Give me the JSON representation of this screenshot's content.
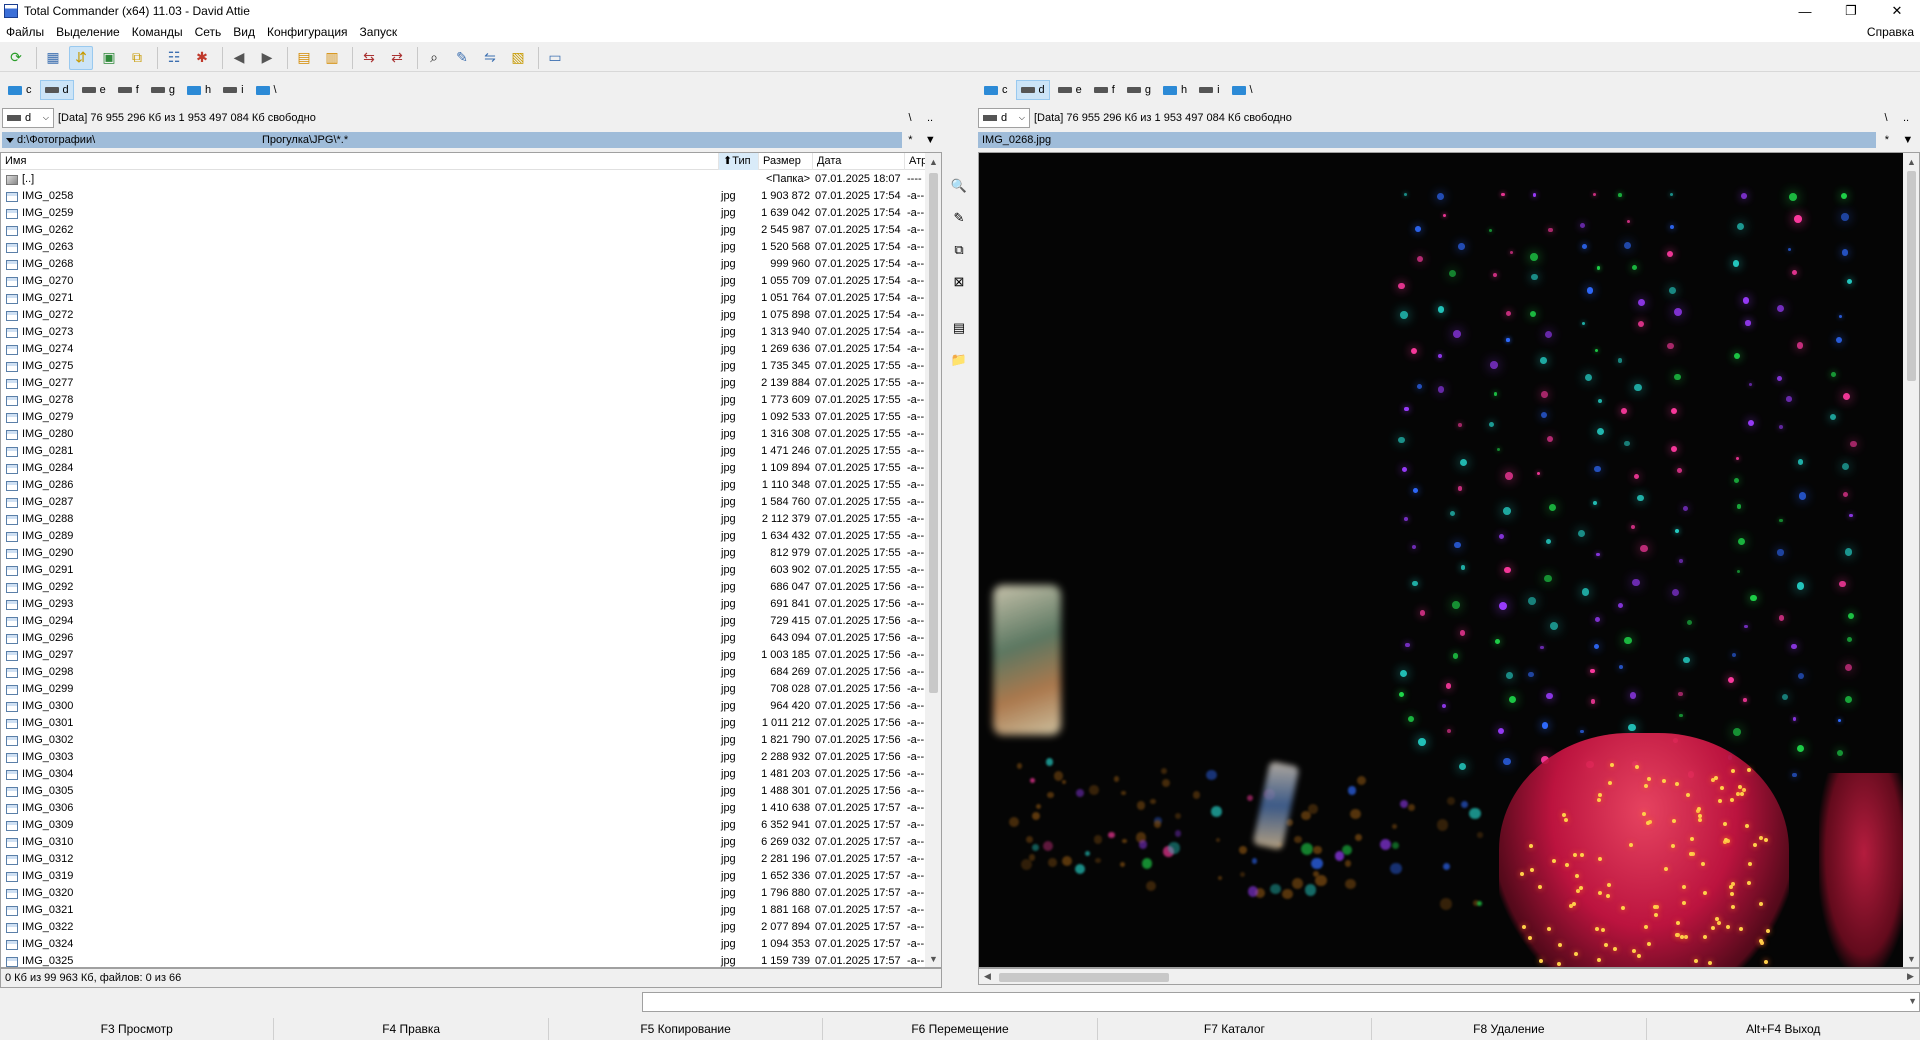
{
  "window": {
    "title": "Total Commander (x64) 11.03 - David Attie",
    "minimize": "—",
    "restore": "❐",
    "close": "✕"
  },
  "menu": {
    "items": [
      "Файлы",
      "Выделение",
      "Команды",
      "Сеть",
      "Вид",
      "Конфигурация",
      "Запуск"
    ],
    "help": "Справка"
  },
  "toolbar": {
    "buttons": [
      {
        "icon": "refresh-icon",
        "glyph": "⟳",
        "color": "#2a9d2a"
      },
      {
        "icon": "brief-view-icon",
        "glyph": "▦",
        "color": "#3c6fb0"
      },
      {
        "icon": "tree-view-icon",
        "glyph": "⇵",
        "color": "#c79a00"
      },
      {
        "icon": "thumbnails-icon",
        "glyph": "▣",
        "color": "#2f8a3a"
      },
      {
        "icon": "branch-view-icon",
        "glyph": "⧉",
        "color": "#c79a00"
      },
      {
        "icon": "select-files-icon",
        "glyph": "☷",
        "color": "#3c6fb0"
      },
      {
        "icon": "invert-selection-icon",
        "glyph": "✱",
        "color": "#c0392b"
      },
      {
        "icon": "back-icon",
        "glyph": "◀",
        "color": "#555"
      },
      {
        "icon": "forward-icon",
        "glyph": "▶",
        "color": "#555"
      },
      {
        "icon": "pack-icon",
        "glyph": "▤",
        "color": "#d48a00"
      },
      {
        "icon": "unpack-icon",
        "glyph": "▥",
        "color": "#d48a00"
      },
      {
        "icon": "ftp-connect-icon",
        "glyph": "⇆",
        "color": "#a33"
      },
      {
        "icon": "url-connect-icon",
        "glyph": "⇄",
        "color": "#a33"
      },
      {
        "icon": "search-icon",
        "glyph": "⌕",
        "color": "#222"
      },
      {
        "icon": "multi-rename-icon",
        "glyph": "✎",
        "color": "#3c6fb0"
      },
      {
        "icon": "sync-dirs-icon",
        "glyph": "⇋",
        "color": "#3c6fb0"
      },
      {
        "icon": "compare-files-icon",
        "glyph": "▧",
        "color": "#c79a00"
      },
      {
        "icon": "notepad-icon",
        "glyph": "▭",
        "color": "#3c6fb0"
      }
    ]
  },
  "drives": [
    "c",
    "d",
    "e",
    "f",
    "g",
    "h",
    "i",
    "\\"
  ],
  "left": {
    "drive_combo": "d",
    "free_info": "[Data]  76 955 296 Кб из 1 953 497 084 Кб свободно",
    "root_btn": "\\",
    "up_btn": "..",
    "path": "d:\\Фотографии\\",
    "filter": "Прогулка\\JPG\\*.*",
    "star": "*",
    "dd": "▼",
    "columns": {
      "name": "Имя",
      "ext": "⬆Тип",
      "size": "Размер",
      "date": "Дата",
      "attr": "Атриб"
    },
    "up_row": {
      "name": "[..]",
      "size": "<Папка>",
      "date": "07.01.2025 18:07",
      "attr": "----"
    },
    "files": [
      [
        "IMG_0258",
        "jpg",
        "1 903 872",
        "07.01.2025 17:54",
        "-a--"
      ],
      [
        "IMG_0259",
        "jpg",
        "1 639 042",
        "07.01.2025 17:54",
        "-a--"
      ],
      [
        "IMG_0262",
        "jpg",
        "2 545 987",
        "07.01.2025 17:54",
        "-a--"
      ],
      [
        "IMG_0263",
        "jpg",
        "1 520 568",
        "07.01.2025 17:54",
        "-a--"
      ],
      [
        "IMG_0268",
        "jpg",
        "999 960",
        "07.01.2025 17:54",
        "-a--"
      ],
      [
        "IMG_0270",
        "jpg",
        "1 055 709",
        "07.01.2025 17:54",
        "-a--"
      ],
      [
        "IMG_0271",
        "jpg",
        "1 051 764",
        "07.01.2025 17:54",
        "-a--"
      ],
      [
        "IMG_0272",
        "jpg",
        "1 075 898",
        "07.01.2025 17:54",
        "-a--"
      ],
      [
        "IMG_0273",
        "jpg",
        "1 313 940",
        "07.01.2025 17:54",
        "-a--"
      ],
      [
        "IMG_0274",
        "jpg",
        "1 269 636",
        "07.01.2025 17:54",
        "-a--"
      ],
      [
        "IMG_0275",
        "jpg",
        "1 735 345",
        "07.01.2025 17:55",
        "-a--"
      ],
      [
        "IMG_0277",
        "jpg",
        "2 139 884",
        "07.01.2025 17:55",
        "-a--"
      ],
      [
        "IMG_0278",
        "jpg",
        "1 773 609",
        "07.01.2025 17:55",
        "-a--"
      ],
      [
        "IMG_0279",
        "jpg",
        "1 092 533",
        "07.01.2025 17:55",
        "-a--"
      ],
      [
        "IMG_0280",
        "jpg",
        "1 316 308",
        "07.01.2025 17:55",
        "-a--"
      ],
      [
        "IMG_0281",
        "jpg",
        "1 471 246",
        "07.01.2025 17:55",
        "-a--"
      ],
      [
        "IMG_0284",
        "jpg",
        "1 109 894",
        "07.01.2025 17:55",
        "-a--"
      ],
      [
        "IMG_0286",
        "jpg",
        "1 110 348",
        "07.01.2025 17:55",
        "-a--"
      ],
      [
        "IMG_0287",
        "jpg",
        "1 584 760",
        "07.01.2025 17:55",
        "-a--"
      ],
      [
        "IMG_0288",
        "jpg",
        "2 112 379",
        "07.01.2025 17:55",
        "-a--"
      ],
      [
        "IMG_0289",
        "jpg",
        "1 634 432",
        "07.01.2025 17:55",
        "-a--"
      ],
      [
        "IMG_0290",
        "jpg",
        "812 979",
        "07.01.2025 17:55",
        "-a--"
      ],
      [
        "IMG_0291",
        "jpg",
        "603 902",
        "07.01.2025 17:55",
        "-a--"
      ],
      [
        "IMG_0292",
        "jpg",
        "686 047",
        "07.01.2025 17:56",
        "-a--"
      ],
      [
        "IMG_0293",
        "jpg",
        "691 841",
        "07.01.2025 17:56",
        "-a--"
      ],
      [
        "IMG_0294",
        "jpg",
        "729 415",
        "07.01.2025 17:56",
        "-a--"
      ],
      [
        "IMG_0296",
        "jpg",
        "643 094",
        "07.01.2025 17:56",
        "-a--"
      ],
      [
        "IMG_0297",
        "jpg",
        "1 003 185",
        "07.01.2025 17:56",
        "-a--"
      ],
      [
        "IMG_0298",
        "jpg",
        "684 269",
        "07.01.2025 17:56",
        "-a--"
      ],
      [
        "IMG_0299",
        "jpg",
        "708 028",
        "07.01.2025 17:56",
        "-a--"
      ],
      [
        "IMG_0300",
        "jpg",
        "964 420",
        "07.01.2025 17:56",
        "-a--"
      ],
      [
        "IMG_0301",
        "jpg",
        "1 011 212",
        "07.01.2025 17:56",
        "-a--"
      ],
      [
        "IMG_0302",
        "jpg",
        "1 821 790",
        "07.01.2025 17:56",
        "-a--"
      ],
      [
        "IMG_0303",
        "jpg",
        "2 288 932",
        "07.01.2025 17:56",
        "-a--"
      ],
      [
        "IMG_0304",
        "jpg",
        "1 481 203",
        "07.01.2025 17:56",
        "-a--"
      ],
      [
        "IMG_0305",
        "jpg",
        "1 488 301",
        "07.01.2025 17:56",
        "-a--"
      ],
      [
        "IMG_0306",
        "jpg",
        "1 410 638",
        "07.01.2025 17:57",
        "-a--"
      ],
      [
        "IMG_0309",
        "jpg",
        "6 352 941",
        "07.01.2025 17:57",
        "-a--"
      ],
      [
        "IMG_0310",
        "jpg",
        "6 269 032",
        "07.01.2025 17:57",
        "-a--"
      ],
      [
        "IMG_0312",
        "jpg",
        "2 281 196",
        "07.01.2025 17:57",
        "-a--"
      ],
      [
        "IMG_0319",
        "jpg",
        "1 652 336",
        "07.01.2025 17:57",
        "-a--"
      ],
      [
        "IMG_0320",
        "jpg",
        "1 796 880",
        "07.01.2025 17:57",
        "-a--"
      ],
      [
        "IMG_0321",
        "jpg",
        "1 881 168",
        "07.01.2025 17:57",
        "-a--"
      ],
      [
        "IMG_0322",
        "jpg",
        "2 077 894",
        "07.01.2025 17:57",
        "-a--"
      ],
      [
        "IMG_0324",
        "jpg",
        "1 094 353",
        "07.01.2025 17:57",
        "-a--"
      ],
      [
        "IMG_0325",
        "jpg",
        "1 159 739",
        "07.01.2025 17:57",
        "-a--"
      ]
    ],
    "status": "0 Кб из 99 963 Кб, файлов: 0 из 66"
  },
  "right": {
    "drive_combo": "d",
    "free_info": "[Data]  76 955 296 Кб из 1 953 497 084 Кб свободно",
    "root_btn": "\\",
    "up_btn": "..",
    "path": "IMG_0268.jpg",
    "star": "*",
    "dd": "▼"
  },
  "midbar": [
    {
      "icon": "view-file-icon",
      "glyph": "🔍"
    },
    {
      "icon": "edit-file-icon",
      "glyph": "✎"
    },
    {
      "icon": "copy-file-icon",
      "glyph": "⧉"
    },
    {
      "icon": "delete-file-icon",
      "glyph": "⊠"
    },
    {
      "icon": "pack-files-icon",
      "glyph": "▤"
    },
    {
      "icon": "new-folder-icon",
      "glyph": "📁"
    }
  ],
  "fkeys": [
    "F3 Просмотр",
    "F4 Правка",
    "F5 Копирование",
    "F6 Перемещение",
    "F7 Каталог",
    "F8 Удаление",
    "Alt+F4 Выход"
  ]
}
